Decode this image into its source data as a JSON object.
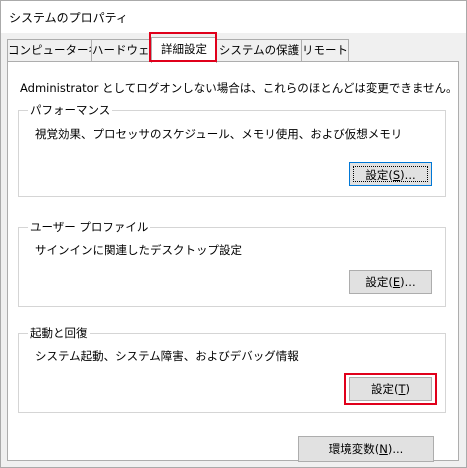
{
  "window": {
    "title": "システムのプロパティ"
  },
  "tabs": [
    {
      "label": "コンピューター名"
    },
    {
      "label": "ハードウェア"
    },
    {
      "label": "詳細設定"
    },
    {
      "label": "システムの保護"
    },
    {
      "label": "リモート"
    }
  ],
  "notice": "Administrator としてログオンしない場合は、これらのほとんどは変更できません。",
  "performance": {
    "title": "パフォーマンス",
    "description": "視覚効果、プロセッサのスケジュール、メモリ使用、および仮想メモリ",
    "button": {
      "prefix": "設定(",
      "access": "S",
      "suffix": ")..."
    }
  },
  "user_profile": {
    "title": "ユーザー プロファイル",
    "description": "サインインに関連したデスクトップ設定",
    "button": {
      "prefix": "設定(",
      "access": "E",
      "suffix": ")..."
    }
  },
  "startup_recovery": {
    "title": "起動と回復",
    "description": "システム起動、システム障害、およびデバッグ情報",
    "button": {
      "prefix": "設定(",
      "access": "T",
      "suffix": ")"
    }
  },
  "env_button": {
    "prefix": "環境変数(",
    "access": "N",
    "suffix": ")..."
  },
  "highlight_color": "#e0001b"
}
